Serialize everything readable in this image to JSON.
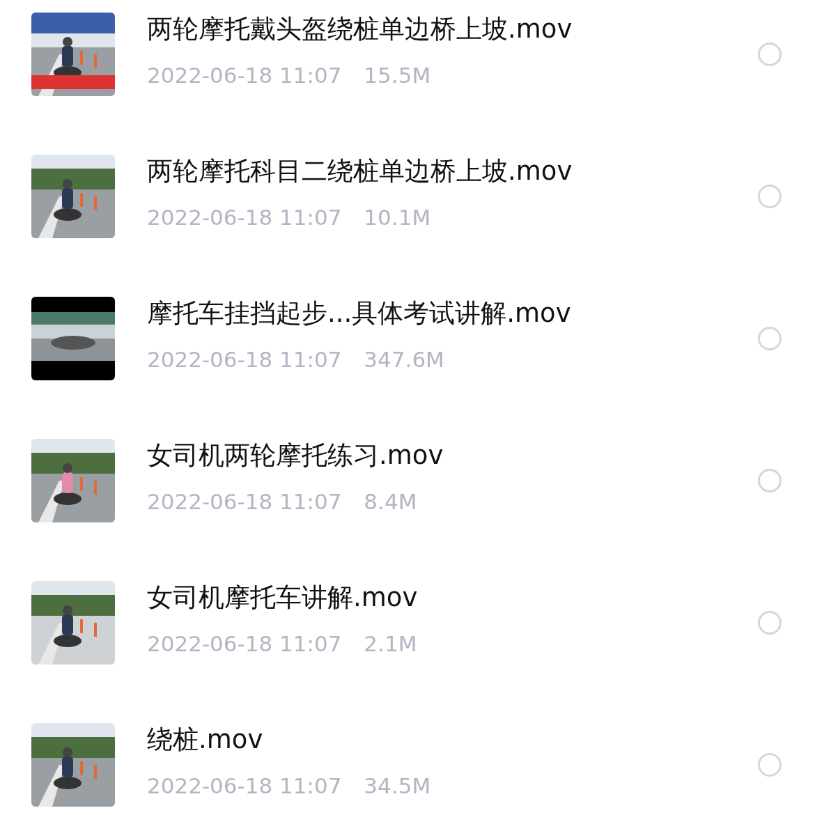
{
  "files": [
    {
      "name": "两轮摩托戴头盔绕桩单边桥上坡.mov",
      "date": "2022-06-18 11:07",
      "size": "15.5M",
      "selected": false
    },
    {
      "name": "两轮摩托科目二绕桩单边桥上坡.mov",
      "date": "2022-06-18 11:07",
      "size": "10.1M",
      "selected": false
    },
    {
      "name": "摩托车挂挡起步...具体考试讲解.mov",
      "date": "2022-06-18 11:07",
      "size": "347.6M",
      "selected": false
    },
    {
      "name": "女司机两轮摩托练习.mov",
      "date": "2022-06-18 11:07",
      "size": "8.4M",
      "selected": false
    },
    {
      "name": "女司机摩托车讲解.mov",
      "date": "2022-06-18 11:07",
      "size": "2.1M",
      "selected": false
    },
    {
      "name": "绕桩.mov",
      "date": "2022-06-18 11:07",
      "size": "34.5M",
      "selected": false
    }
  ]
}
